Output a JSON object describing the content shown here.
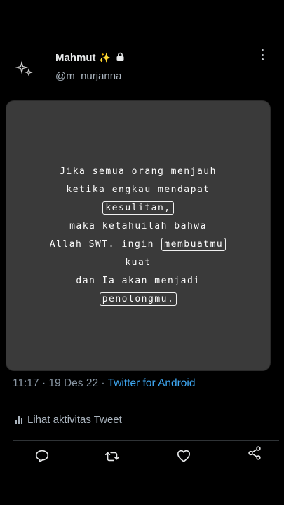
{
  "tweet": {
    "display_name": "Mahmut",
    "handle": "@m_nurjanna",
    "quote_lines": [
      [
        "Jika semua orang menjauh"
      ],
      [
        "ketika engkau mendapat"
      ],
      [
        "kesulitan,"
      ],
      [
        "maka ketahuilah bahwa"
      ],
      [
        "Allah SWT. ingin ",
        "membuatmu"
      ],
      [
        "kuat"
      ],
      [
        "dan Ia akan menjadi"
      ],
      [
        "penolongmu."
      ]
    ],
    "timestamp": "11:17 · 19 Des 22 · ",
    "source": "Twitter for Android",
    "activity_label": "Lihat aktivitas Tweet"
  },
  "icons": {
    "avatar": "sparkle-icon",
    "verified_extra": "sparkles-icon",
    "lock": "lock-icon",
    "more": "more-vertical-icon",
    "reply": "reply-icon",
    "retweet": "retweet-icon",
    "like": "heart-icon",
    "share": "share-icon",
    "activity": "bar-chart-icon"
  },
  "colors": {
    "background": "#000000",
    "card": "#3a3a3a",
    "link": "#3fa9f5",
    "muted": "#8b98a5"
  }
}
